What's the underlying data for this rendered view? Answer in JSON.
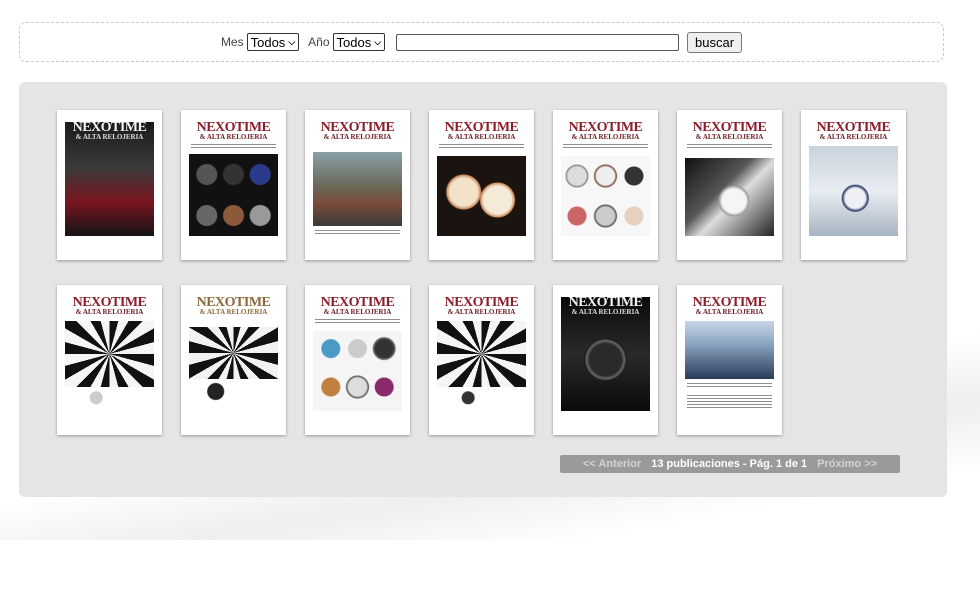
{
  "filters": {
    "month_label": "Mes",
    "month_value": "Todos",
    "year_label": "Año",
    "year_value": "Todos",
    "search_value": "",
    "search_button": "buscar"
  },
  "magazine": {
    "title": "NEXOTIME",
    "subtitle": "& ALTA RELOJERIA"
  },
  "covers": [
    {
      "art": "dark-cover-watch"
    },
    {
      "art": "grid-watches-blue"
    },
    {
      "art": "building-photo"
    },
    {
      "art": "gold-watches"
    },
    {
      "art": "grid-watches-light"
    },
    {
      "art": "bw-watch-closeup"
    },
    {
      "art": "snow-watch"
    },
    {
      "art": "op-art-watch"
    },
    {
      "art": "op-art-watch-2"
    },
    {
      "art": "grid-watches-colorful"
    },
    {
      "art": "op-art-watch-3"
    },
    {
      "art": "black-cover-watch"
    },
    {
      "art": "city-photo"
    }
  ],
  "pagination": {
    "prev": "<< Anterior",
    "status": "13 publicaciones - Pág. 1 de 1",
    "next": "Próximo >>"
  }
}
